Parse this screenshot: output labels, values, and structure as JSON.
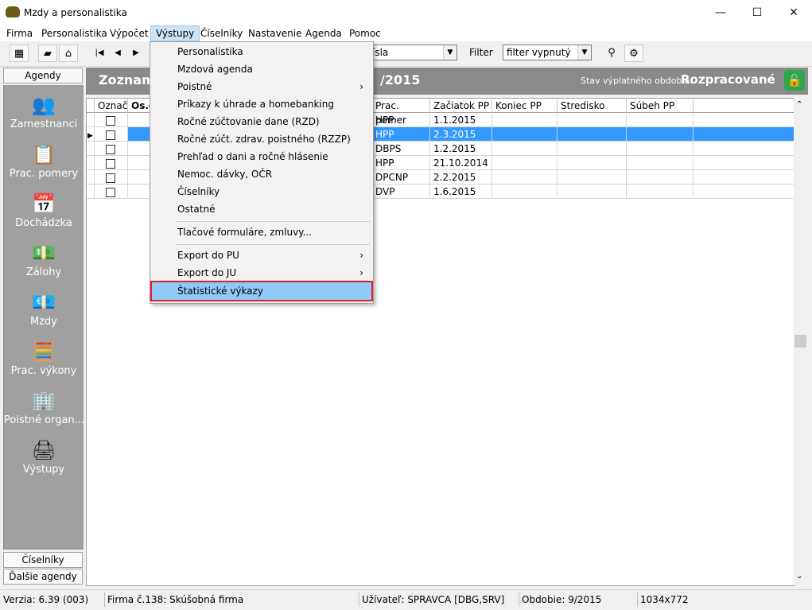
{
  "window": {
    "title": "Mzdy a personalistika",
    "minimize": "—",
    "maximize": "☐",
    "close": "✕"
  },
  "menubar": [
    "Firma",
    "Personalistika",
    "Výpočet",
    "Výstupy",
    "Číselníky",
    "Nastavenie",
    "Agenda",
    "Pomoc"
  ],
  "toolbar": {
    "sort_combo_value": "ísla",
    "filter_label": "Filter",
    "filter_value": "filter vypnutý"
  },
  "sidebar": {
    "top_tab": "Agendy",
    "items": [
      "Zamestnanci",
      "Prac. pomery",
      "Dochádzka",
      "Zálohy",
      "Mzdy",
      "Prac. výkony",
      "Poistné organ...",
      "Výstupy"
    ],
    "bottom_tabs": [
      "Číselníky",
      "Ďalšie agendy"
    ]
  },
  "header": {
    "title_left": "Zoznam",
    "title_right": "/2015",
    "status_label": "Stav výplatného obdobia:",
    "status_value": "Rozpracované"
  },
  "grid": {
    "columns": [
      "Označ",
      "Os.č",
      "Prac. pomer",
      "Začiatok PP",
      "Koniec PP",
      "Stredisko",
      "Súbeh PP"
    ],
    "rows": [
      {
        "type": "HPP",
        "start": "1.1.2015",
        "selected": false
      },
      {
        "type": "HPP",
        "start": "2.3.2015",
        "selected": true
      },
      {
        "type": "DBPS",
        "start": "1.2.2015",
        "selected": false
      },
      {
        "type": "HPP",
        "start": "21.10.2014",
        "selected": false
      },
      {
        "type": "DPCNP",
        "start": "2.2.2015",
        "selected": false
      },
      {
        "type": "DVP",
        "start": "1.6.2015",
        "selected": false
      }
    ]
  },
  "dropdown": {
    "items": [
      {
        "label": "Personalistika",
        "submenu": false
      },
      {
        "label": "Mzdová agenda",
        "submenu": false
      },
      {
        "label": "Poistné",
        "submenu": true
      },
      {
        "label": "Príkazy k úhrade a homebanking",
        "submenu": false
      },
      {
        "label": "Ročné zúčtovanie dane (RZD)",
        "submenu": false
      },
      {
        "label": "Ročné zúčt. zdrav. poistného (RZZP)",
        "submenu": false
      },
      {
        "label": "Prehľad  o dani a ročné hlásenie",
        "submenu": false
      },
      {
        "label": "Nemoc. dávky, OČR",
        "submenu": false
      },
      {
        "label": "Číselníky",
        "submenu": false
      },
      {
        "label": "Ostatné",
        "submenu": false
      },
      {
        "label": "Tlačové formuláre, zmluvy...",
        "submenu": false
      },
      {
        "label": "Export do PU",
        "submenu": true
      },
      {
        "label": "Export do JU",
        "submenu": true
      },
      {
        "label": "Štatistické výkazy",
        "submenu": false
      }
    ]
  },
  "statusbar": {
    "version": "Verzia: 6.39 (003)",
    "company": "Firma č.138: Skúšobná firma",
    "user": "Užívateľ: SPRAVCA [DBG,SRV]",
    "period": "Obdobie: 9/2015",
    "resolution": "1034x772"
  },
  "colors": {
    "selection": "#3399ff",
    "menu_highlight": "#91c9f7",
    "highlight_border": "#e01f26",
    "sidebar_bg": "#a0a0a0",
    "header_bg": "#8a8a8a"
  }
}
